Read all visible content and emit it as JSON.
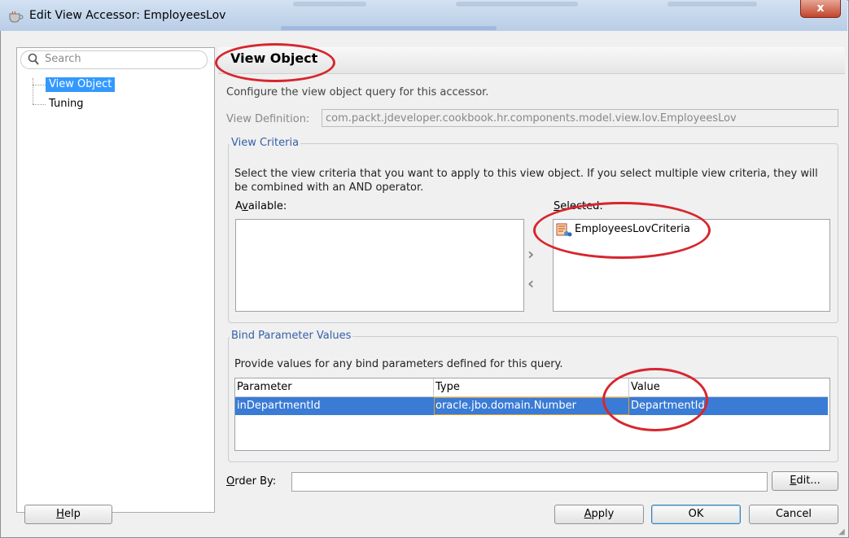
{
  "window": {
    "title": "Edit View Accessor: EmployeesLov",
    "close_symbol": "x",
    "icon": "coffee-cup-icon"
  },
  "nav": {
    "search_placeholder": "Search",
    "items": [
      {
        "label": "View Object",
        "selected": true
      },
      {
        "label": "Tuning",
        "selected": false
      }
    ]
  },
  "page": {
    "title": "View Object",
    "intro": "Configure the view object query for this accessor.",
    "view_definition_label": "View Definition:",
    "view_definition_value": "com.packt.jdeveloper.cookbook.hr.components.model.view.lov.EmployeesLov"
  },
  "view_criteria": {
    "legend": "View Criteria",
    "description": "Select the view criteria that you want to apply to this view object. If you select multiple view criteria, they will be combined with an AND operator.",
    "available_label_pre": "A",
    "available_label_mn": "v",
    "available_label_post": "ailable:",
    "selected_label_mn": "S",
    "selected_label_post": "elected:",
    "available_items": [],
    "selected_items": [
      "EmployeesLovCriteria"
    ],
    "move_right_symbol": "›",
    "move_left_symbol": "‹"
  },
  "bind_params": {
    "legend": "Bind Parameter Values",
    "description": "Provide values for any bind parameters defined for this query.",
    "columns": [
      "Parameter",
      "Type",
      "Value"
    ],
    "rows": [
      {
        "parameter": "inDepartmentId",
        "type": "oracle.jbo.domain.Number",
        "value": "DepartmentId"
      }
    ]
  },
  "order_by": {
    "label_mn": "O",
    "label_post": "rder By:",
    "value": "",
    "edit_button_mn": "E",
    "edit_button_post": "dit..."
  },
  "footer": {
    "help_mn": "H",
    "help_post": "elp",
    "apply_mn": "A",
    "apply_post": "pply",
    "ok": "OK",
    "cancel": "Cancel"
  },
  "colors": {
    "selection": "#3a7bd5",
    "annotation": "#d7262e",
    "legend_text": "#3560a8"
  }
}
